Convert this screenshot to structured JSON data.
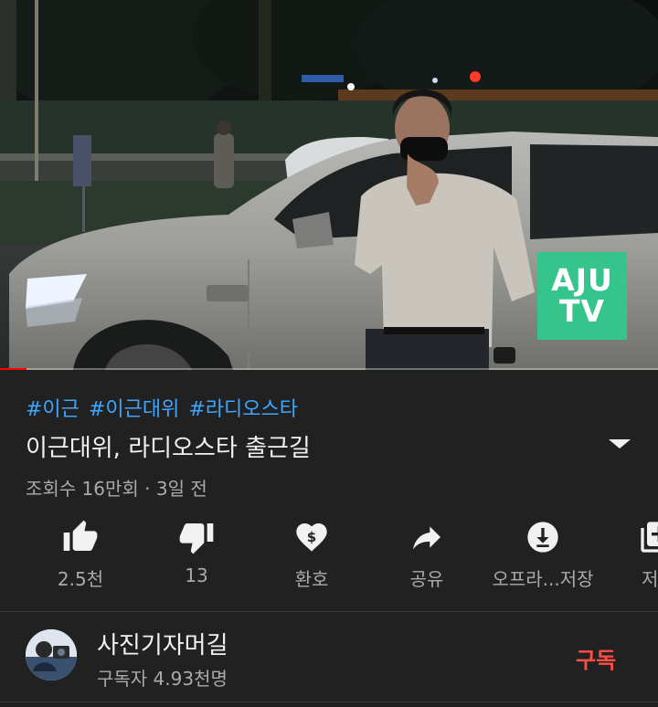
{
  "video": {
    "watermark_line1": "AJU",
    "watermark_line2": "TV",
    "progress_fraction": 0.04
  },
  "hashtags": [
    "#이근",
    "#이근대위",
    "#라디오스타"
  ],
  "title": "이근대위, 라디오스타 출근길",
  "meta": "조회수 16만회 · 3일 전",
  "actions": {
    "like": {
      "label": "2.5천",
      "icon": "thumbs-up-icon"
    },
    "dislike": {
      "label": "13",
      "icon": "thumbs-down-icon"
    },
    "thanks": {
      "label": "환호",
      "icon": "heart-dollar-icon"
    },
    "share": {
      "label": "공유",
      "icon": "share-arrow-icon"
    },
    "download": {
      "label": "오프라...저장",
      "icon": "download-icon"
    },
    "save": {
      "label": "저",
      "icon": "playlist-add-icon"
    }
  },
  "channel": {
    "name": "사진기자머길",
    "subscribers": "구독자 4.93천명",
    "subscribe_label": "구독"
  },
  "colors": {
    "background": "#212121",
    "hashtag": "#3ea6ff",
    "subscribe": "#ff4e45",
    "progress": "#ff0000",
    "watermark": "#35c48c"
  }
}
